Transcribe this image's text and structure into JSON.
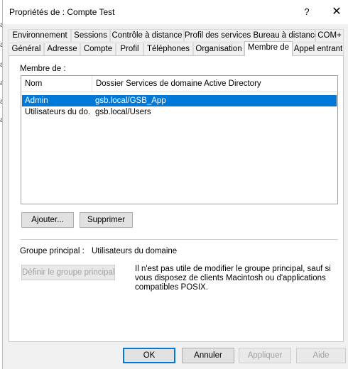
{
  "background_chars": [
    "a",
    "a",
    "a",
    "a",
    "a",
    "a"
  ],
  "window": {
    "title": "Propriétés de : Compte Test",
    "help_glyph": "?",
    "close_glyph": "✕"
  },
  "tabs": {
    "row1": [
      "Environnement",
      "Sessions",
      "Contrôle à distance",
      "Profil des services Bureau à distance",
      "COM+"
    ],
    "row2": [
      "Général",
      "Adresse",
      "Compte",
      "Profil",
      "Téléphones",
      "Organisation",
      "Membre de",
      "Appel entrant"
    ],
    "active": "Membre de"
  },
  "member_of": {
    "label": "Membre de :",
    "columns": [
      "Nom",
      "Dossier Services de domaine Active Directory"
    ],
    "rows": [
      {
        "name": "Admin",
        "folder": "gsb.local/GSB_App",
        "selected": true
      },
      {
        "name": "Utilisateurs du do...",
        "folder": "gsb.local/Users",
        "selected": false
      }
    ],
    "add_button": "Ajouter...",
    "remove_button": "Supprimer"
  },
  "primary_group": {
    "label": "Groupe principal :",
    "value": "Utilisateurs du domaine",
    "set_button": "Définir le groupe principal",
    "info": "Il n'est pas utile de modifier le groupe principal, sauf si vous disposez de clients Macintosh ou d'applications compatibles POSIX."
  },
  "footer": {
    "ok": "OK",
    "cancel": "Annuler",
    "apply": "Appliquer",
    "help": "Aide"
  },
  "colors": {
    "selection": "#0078d7",
    "dialog_bg": "#f0f0f0",
    "panel_bg": "#ffffff"
  }
}
